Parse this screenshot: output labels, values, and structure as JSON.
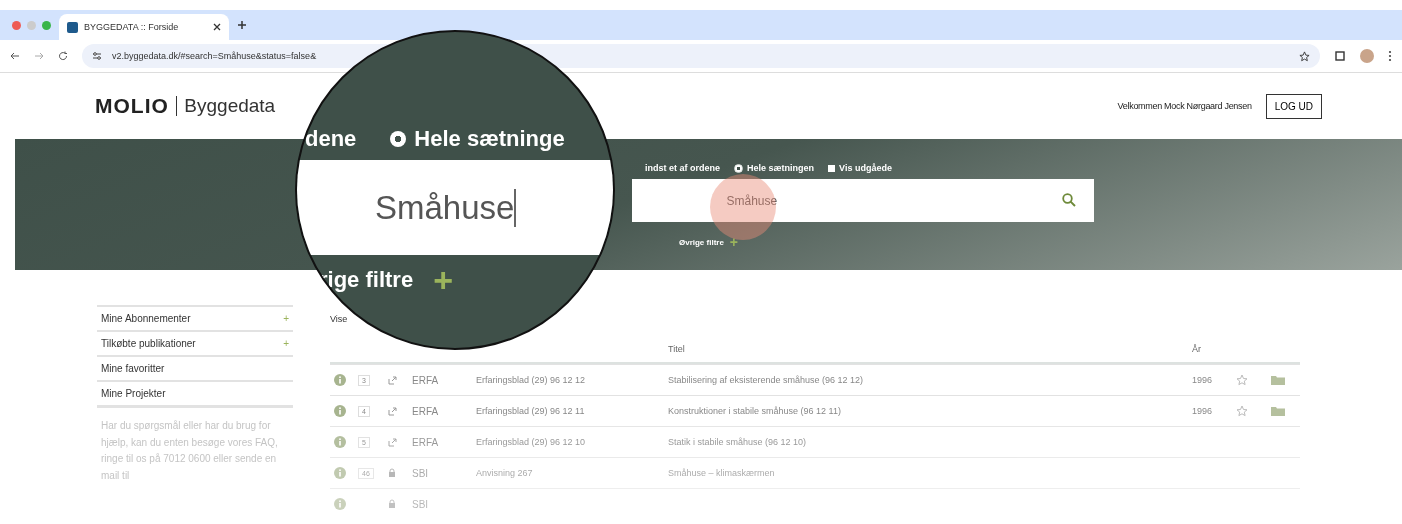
{
  "browser": {
    "tab_title": "BYGGEDATA :: Forside",
    "url": "v2.byggedata.dk/#search=Småhuse&status=false&"
  },
  "header": {
    "logo": "MOLIO",
    "product": "Byggedata",
    "welcome": "Velkommen Mock Nørgaard Jensen",
    "logout": "LOG UD"
  },
  "search": {
    "options": [
      {
        "kind": "radio",
        "label": "indst et af ordene"
      },
      {
        "kind": "radio",
        "label": "Hele sætningen",
        "selected": true
      },
      {
        "kind": "checkbox",
        "label": "Vis udgåede",
        "checked": false
      }
    ],
    "value": "Småhuse",
    "more_filters": "Øvrige filtre",
    "more_filters_icon": "+"
  },
  "magnifier": {
    "option_tail": "dene",
    "option_selected": true,
    "option_label": "Hele sætninge",
    "value": "Småhuse",
    "filters_tail": "rige filtre",
    "filters_icon": "+"
  },
  "sidebar": {
    "items": [
      {
        "label": "Mine Abonnementer",
        "icon": "+"
      },
      {
        "label": "Tilkøbte publikationer",
        "icon": "+"
      },
      {
        "label": "Mine favoritter"
      },
      {
        "label": "Mine Projekter"
      }
    ],
    "help_text": "Har du spørgsmål eller har du brug for hjælp, kan du enten besøge vores FAQ, ringe til os på 7012 0600 eller sende en mail til"
  },
  "results": {
    "showing": "Vise",
    "columns": [
      "Titel",
      "År"
    ],
    "rows": [
      {
        "badge": "3",
        "kind": "link",
        "type": "ERFA",
        "designation": "Erfaringsblad (29) 96 12 12",
        "title": "Stabilisering af eksisterende småhuse (96 12 12)",
        "year": "1996"
      },
      {
        "badge": "4",
        "kind": "link",
        "type": "ERFA",
        "designation": "Erfaringsblad (29) 96 12 11",
        "title": "Konstruktioner i stabile småhuse (96 12 11)",
        "year": "1996"
      },
      {
        "badge": "5",
        "kind": "link",
        "type": "ERFA",
        "designation": "Erfaringsblad (29) 96 12 10",
        "title": "Statik i stabile småhuse (96 12 10)"
      },
      {
        "badge": "46",
        "kind": "lock",
        "type": "SBI",
        "designation": "Anvisning 267",
        "title": "Småhuse – klimaskærmen"
      },
      {
        "kind": "lock",
        "type": "SBI"
      }
    ]
  }
}
